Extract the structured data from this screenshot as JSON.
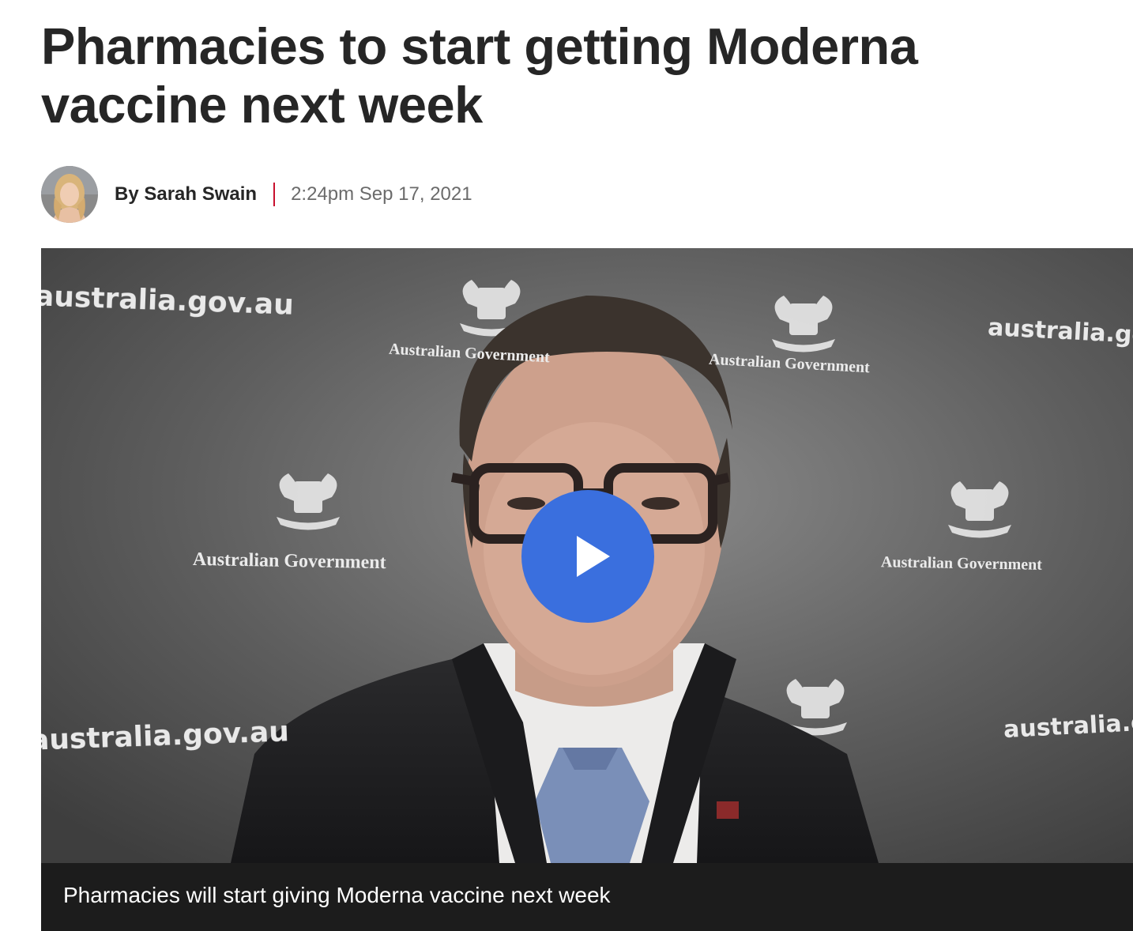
{
  "article": {
    "title": "Pharmacies to start getting Moderna vaccine next week",
    "author": "By Sarah Swain",
    "published": "2:24pm Sep 17, 2021"
  },
  "colors": {
    "headline": "#262626",
    "byline_divider": "#c8102e",
    "timestamp": "#6b6b6b",
    "play_button": "#3a6fde",
    "caption_bar": "#1c1c1c"
  },
  "video": {
    "backdrop": {
      "watermark_url": "australia.gov.au",
      "agency_label": "Australian Government"
    },
    "play_icon": "play-icon",
    "caption": "Pharmacies will start giving Moderna vaccine next week"
  }
}
